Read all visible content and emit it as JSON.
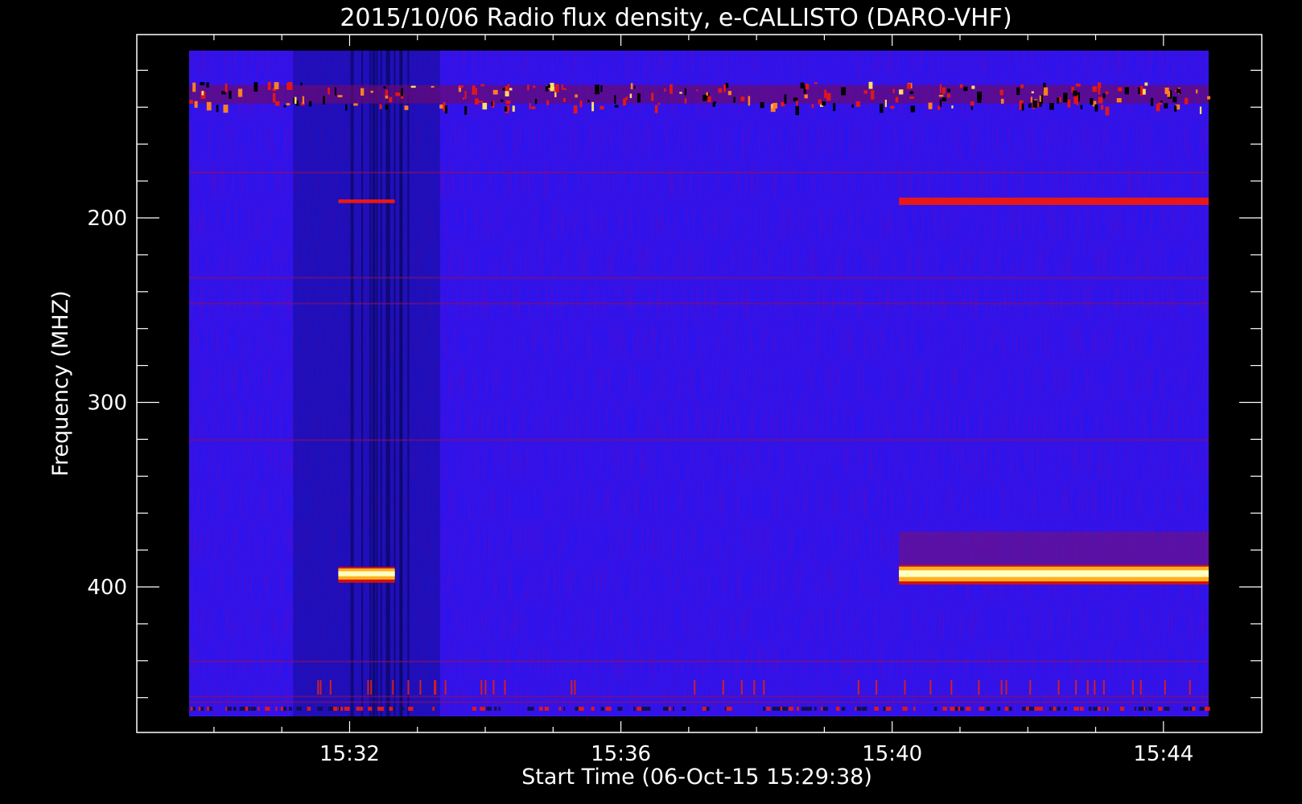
{
  "chart_data": {
    "type": "heatmap",
    "title": "2015/10/06  Radio flux density, e-CALLISTO (DARO-VHF)",
    "xlabel": "Start Time (06-Oct-15 15:29:38)",
    "ylabel": "Frequency (MHZ)",
    "x_ticks": [
      "15:32",
      "15:36",
      "15:40",
      "15:44"
    ],
    "y_ticks": [
      "200",
      "300",
      "400"
    ],
    "x_range_minutes": [
      "15:29:38",
      "15:44:40"
    ],
    "y_range_mhz": [
      110,
      470
    ],
    "y_reversed": true,
    "colormap": [
      "#000000",
      "#1a10ff",
      "#c01010",
      "#ff3010",
      "#ffb020",
      "#ffffc0"
    ],
    "features": [
      {
        "name": "",
        "t_start": "15:31:50",
        "t_end": "15:32:40",
        "f_low": 390,
        "f_high": 396,
        "level": "saturated"
      },
      {
        "name": "",
        "t_start": "15:31:50",
        "t_end": "15:32:40",
        "f_low": 190,
        "f_high": 192,
        "level": "strong"
      },
      {
        "name": "",
        "t_start": "15:40:06",
        "t_end": "15:44:40",
        "f_low": 389,
        "f_high": 397,
        "level": "saturated"
      },
      {
        "name": "",
        "t_start": "15:40:06",
        "t_end": "15:44:40",
        "f_low": 189,
        "f_high": 193,
        "level": "strong"
      },
      {
        "name": "",
        "t_start": "15:29:38",
        "t_end": "15:44:40",
        "f_low": 127,
        "f_high": 138,
        "level": "moderate"
      }
    ]
  }
}
